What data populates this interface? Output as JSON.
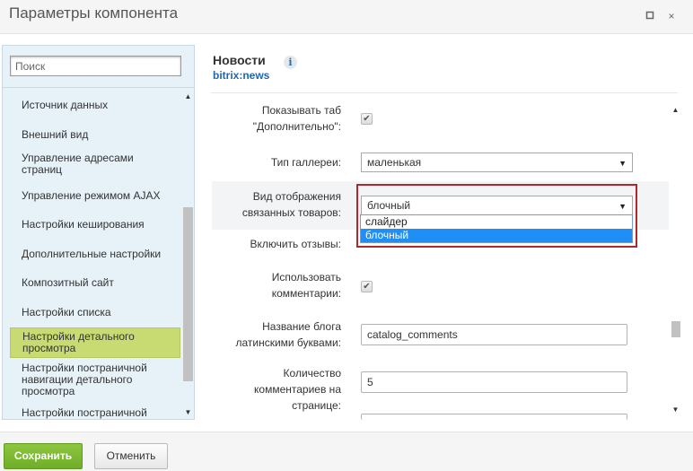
{
  "window": {
    "title": "Параметры компонента",
    "maximize_icon": "square-icon",
    "close_icon": "×"
  },
  "sidebar": {
    "search_placeholder": "Поиск",
    "items": [
      {
        "label": "Источник данных"
      },
      {
        "label": "Внешний вид"
      },
      {
        "label": "Управление адресами страниц"
      },
      {
        "label": "Управление режимом AJAX"
      },
      {
        "label": "Настройки кеширования"
      },
      {
        "label": "Дополнительные настройки"
      },
      {
        "label": "Композитный сайт"
      },
      {
        "label": "Настройки списка"
      },
      {
        "label": "Настройки детального просмотра"
      },
      {
        "label": "Настройки постраничной навигации детального просмотра"
      },
      {
        "label": "Настройки постраничной"
      }
    ],
    "active_index": 8
  },
  "component": {
    "name": "Новости",
    "code": "bitrix:news",
    "info_icon": "i"
  },
  "form": {
    "show_tab_label": "Показывать таб \"Дополнительно\":",
    "show_tab_checked": true,
    "gallery_type_label": "Тип галлереи:",
    "gallery_type_value": "маленькая",
    "related_view_label": "Вид отображения связанных товаров:",
    "related_view_value": "блочный",
    "related_view_options": [
      "слайдер",
      "блочный"
    ],
    "related_view_selected": "блочный",
    "reviews_label": "Включить отзывы:",
    "comments_label": "Использовать комментарии:",
    "comments_checked": true,
    "blog_name_label": "Название блога латинскими буквами:",
    "blog_name_value": "catalog_comments",
    "comments_count_label": "Количество комментариев на странице:",
    "comments_count_value": "5",
    "check_mark": "✔"
  },
  "footer": {
    "save_label": "Сохранить",
    "cancel_label": "Отменить"
  },
  "colors": {
    "save_button": "#7ab833",
    "active_item": "#c8da72",
    "link_blue": "#2067b0",
    "highlight_frame": "#b0272c",
    "dropdown_selected": "#1f8ff5"
  }
}
